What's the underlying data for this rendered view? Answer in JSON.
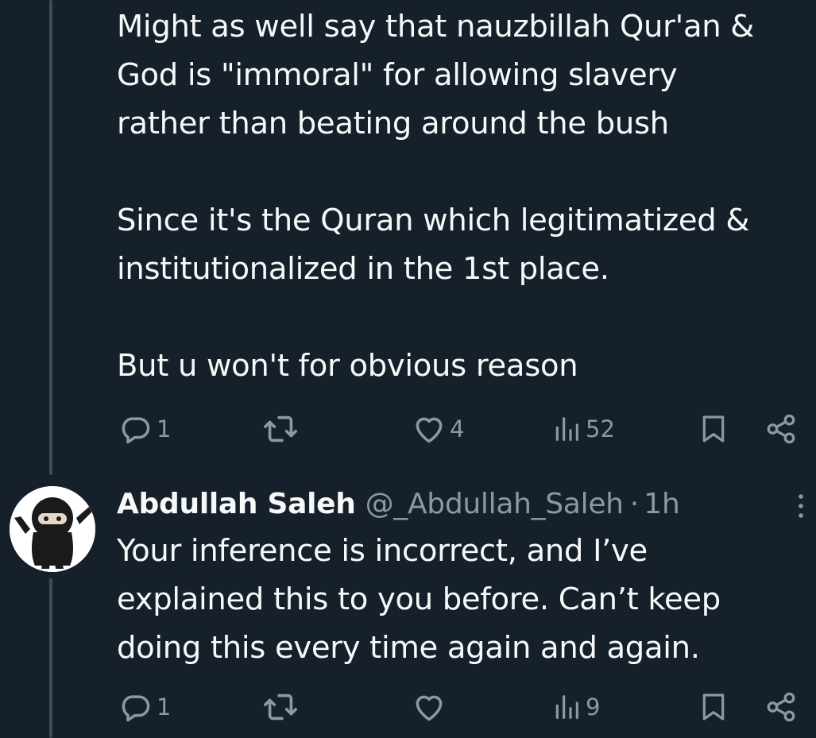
{
  "tweet1": {
    "text": "Might as well say that nauzbillah Qur'an &\nGod is \"immoral\" for allowing slavery\nrather than beating around the bush\n\nSince it's the Quran which legitimatized &\ninstitutionalized in the 1st place.\n\nBut u won't for obvious reason",
    "reply_count": "1",
    "retweet_count": "",
    "like_count": "4",
    "view_count": "52"
  },
  "tweet2": {
    "display_name": "Abdullah Saleh",
    "handle": "@_Abdullah_Saleh",
    "separator": "·",
    "time": "1h",
    "text": "Your inference is incorrect, and I’ve\nexplained this to you before. Can’t keep\ndoing this every time again and again.",
    "reply_count": "1",
    "retweet_count": "",
    "like_count": "",
    "view_count": "9"
  },
  "colors": {
    "background": "#15202b",
    "text_primary": "#f7f9f9",
    "text_secondary": "#8b98a5",
    "thread_line": "#3e4a56"
  },
  "icons": {
    "reply": "reply-icon",
    "retweet": "retweet-icon",
    "like": "heart-icon",
    "views": "views-chart-icon",
    "bookmark": "bookmark-icon",
    "share": "share-icon",
    "more": "more-vertical-icon"
  }
}
